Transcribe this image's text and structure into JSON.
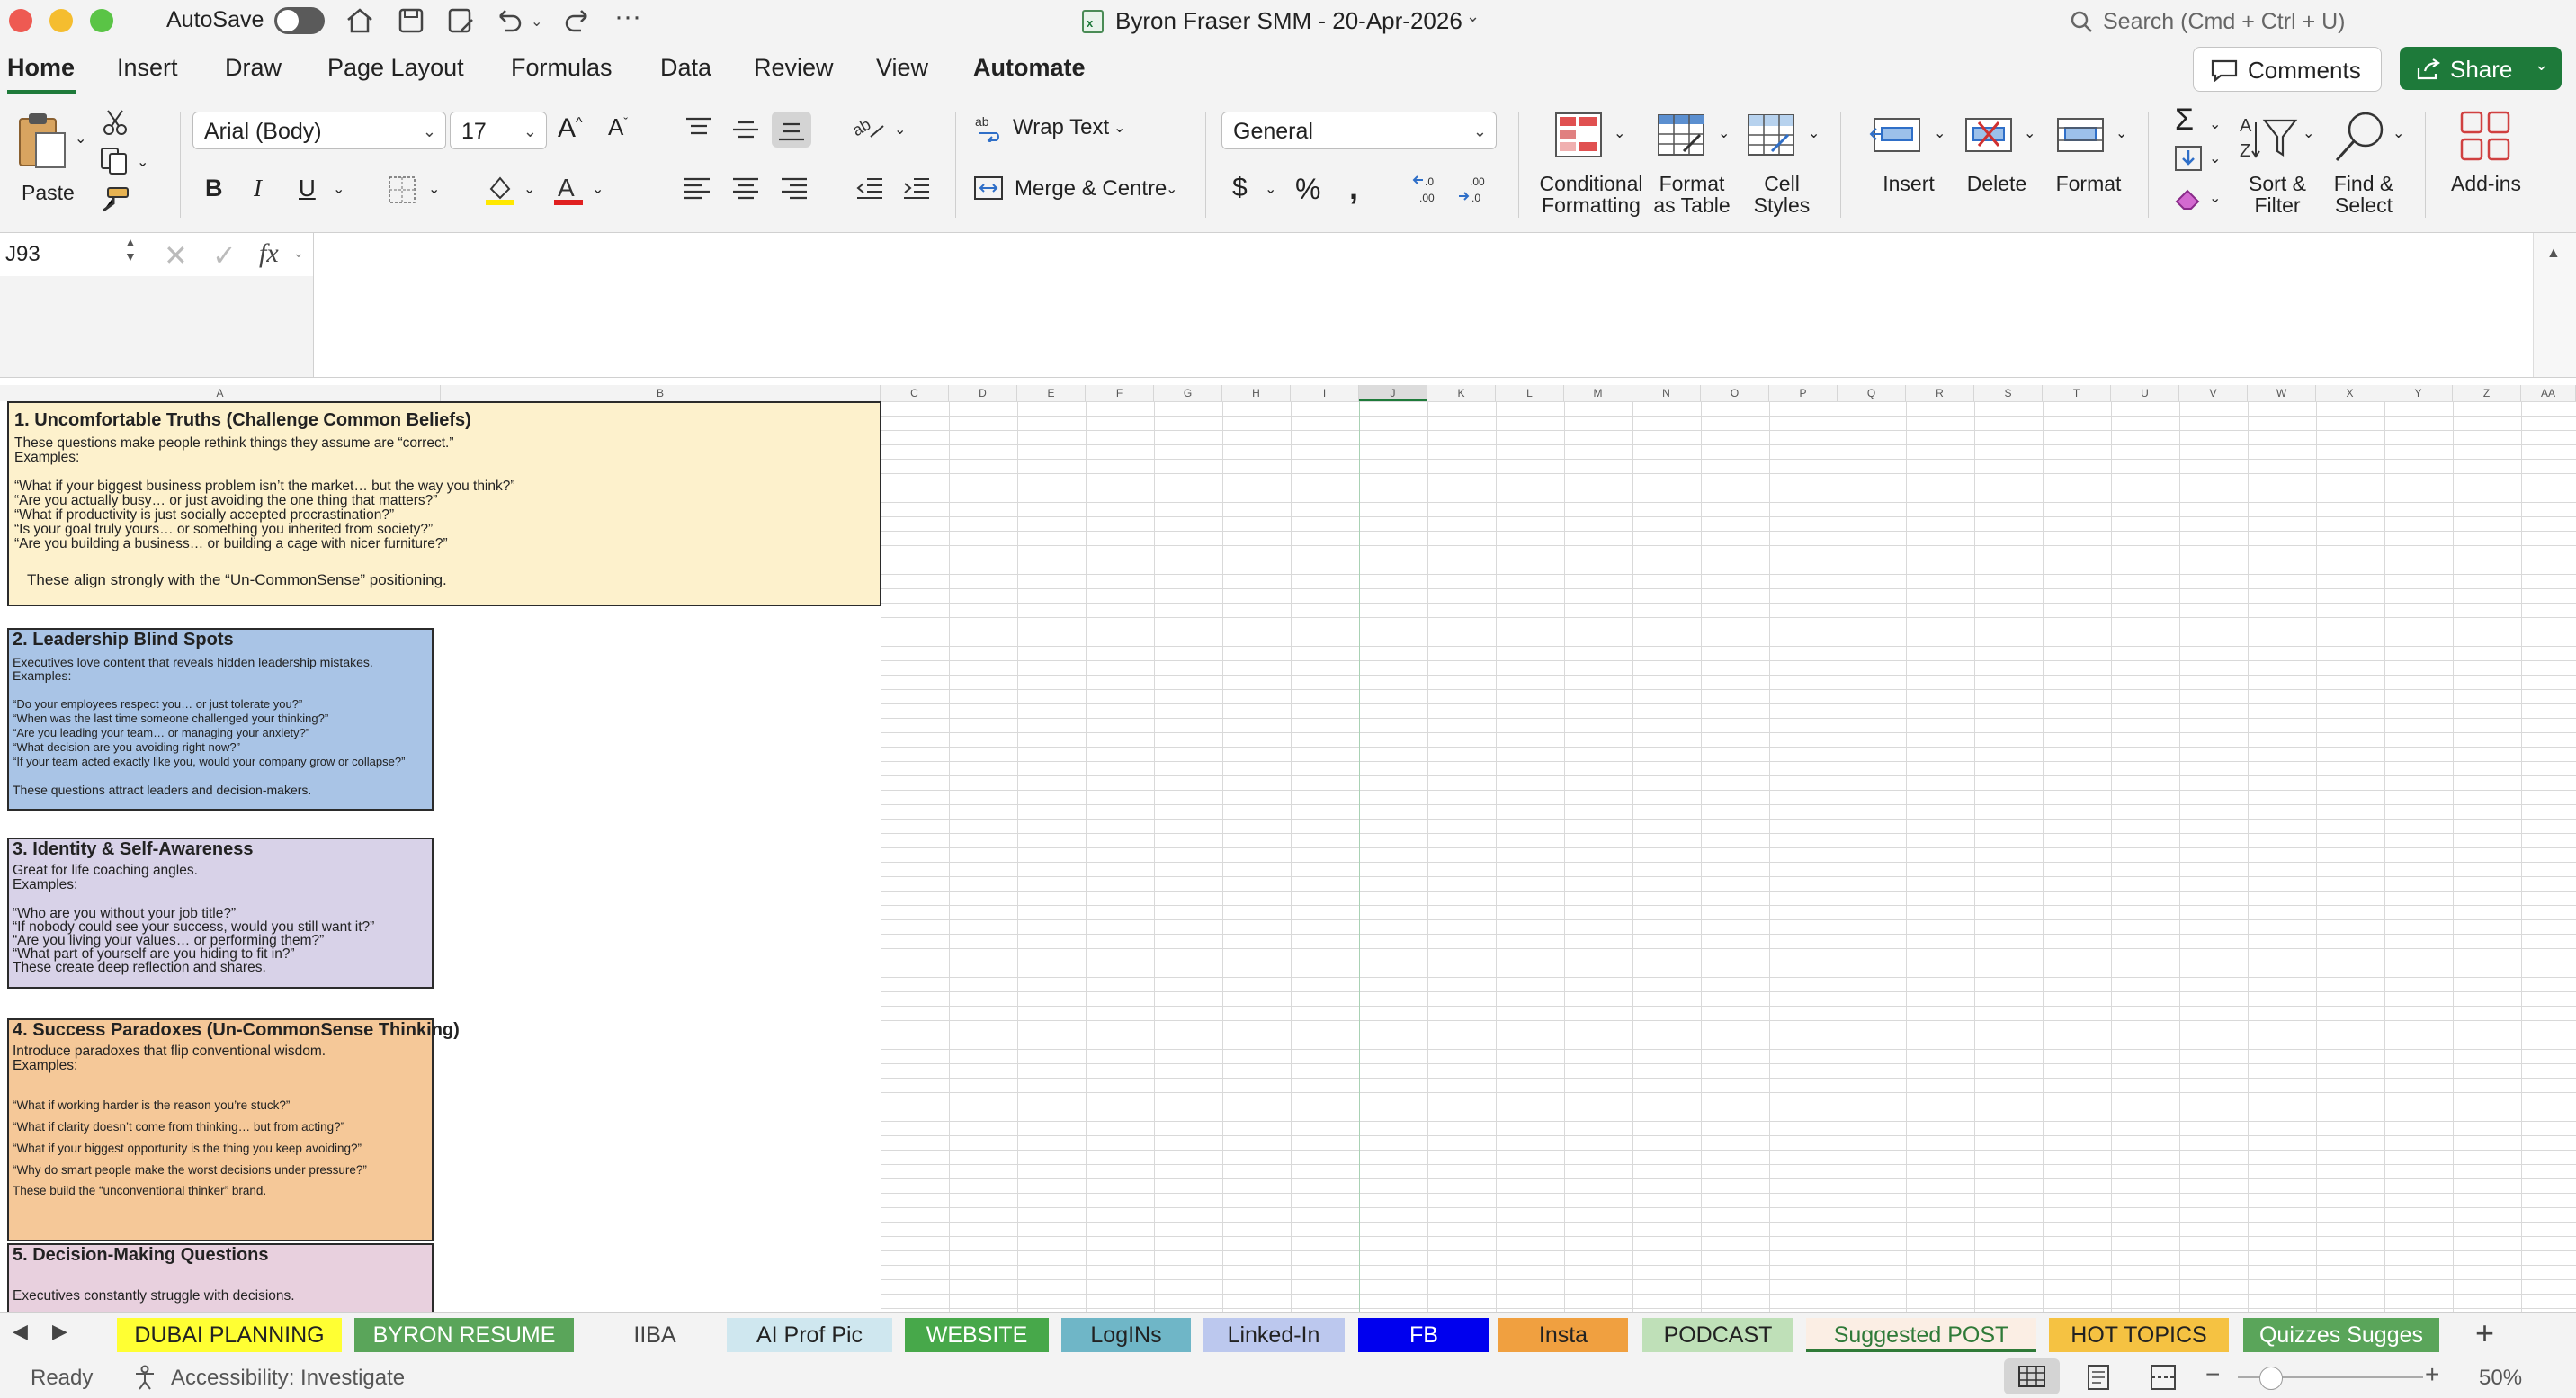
{
  "window": {
    "title": "Byron Fraser SMM - 20-Apr-2026",
    "autosave_label": "AutoSave",
    "search_placeholder": "Search (Cmd + Ctrl + U)"
  },
  "ribbon_tabs": [
    "Home",
    "Insert",
    "Draw",
    "Page Layout",
    "Formulas",
    "Data",
    "Review",
    "View",
    "Automate"
  ],
  "ribbon_buttons": {
    "comments": "Comments",
    "share": "Share",
    "paste": "Paste",
    "font_name": "Arial (Body)",
    "font_size": "17",
    "wrap_text": "Wrap Text",
    "merge_centre": "Merge & Centre",
    "number_format": "General",
    "conditional_formatting": "Conditional\nFormatting",
    "format_as_table": "Format\nas Table",
    "cell_styles": "Cell\nStyles",
    "insert": "Insert",
    "delete": "Delete",
    "format": "Format",
    "sort_filter": "Sort &\nFilter",
    "find_select": "Find &\nSelect",
    "add_ins": "Add-ins",
    "bold": "B",
    "italic": "I",
    "underline": "U"
  },
  "formula_bar": {
    "name_box": "J93",
    "fx": "fx",
    "content": ""
  },
  "columns": [
    "A",
    "B",
    "C",
    "D",
    "E",
    "F",
    "G",
    "H",
    "I",
    "J",
    "K",
    "L",
    "M",
    "N",
    "O",
    "P",
    "Q",
    "R",
    "S",
    "T",
    "U",
    "V",
    "W",
    "X",
    "Y",
    "Z",
    "AA"
  ],
  "selected_column": "J",
  "cards": [
    {
      "heading": "1. Uncomfortable Truths (Challenge Common Beliefs)",
      "intro": "These questions make people rethink things they assume are “correct.”",
      "examples_label": "Examples:",
      "items": [
        "“What if your biggest business problem isn’t the market… but the way you think?”",
        "“Are you actually busy… or just avoiding the one thing that matters?”",
        "“What if productivity is just socially accepted procrastination?”",
        "“Is your goal truly yours… or something you inherited from society?”",
        "“Are you building a business… or building a cage with nicer furniture?”"
      ],
      "footer": "These align strongly with the “Un-CommonSense” positioning.",
      "color": "#fdf1cc"
    },
    {
      "heading": "2. Leadership Blind Spots",
      "intro": "Executives love content that reveals hidden leadership mistakes.",
      "examples_label": "Examples:",
      "items": [
        "“Do your employees respect you… or just tolerate you?”",
        "“When was the last time someone challenged your thinking?”",
        "“Are you leading your team… or managing your anxiety?”",
        "“What decision are you avoiding right now?”",
        "“If your team acted exactly like you, would your company grow or collapse?”"
      ],
      "footer": "These questions attract leaders and decision-makers.",
      "color": "#a9c4e6"
    },
    {
      "heading": "3. Identity & Self-Awareness",
      "intro": "Great for life coaching angles.",
      "examples_label": "Examples:",
      "items": [
        "“Who are you without your job title?”",
        "“If nobody could see your success, would you still want it?”",
        "“Are you living your values… or performing them?”",
        "“What part of yourself are you hiding to fit in?”"
      ],
      "footer": "These create deep reflection and shares.",
      "color": "#d8d2e8"
    },
    {
      "heading": "4. Success Paradoxes (Un-CommonSense Thinking)",
      "intro": "Introduce paradoxes that flip conventional wisdom.",
      "examples_label": "Examples:",
      "items": [
        "“What if working harder is the reason you’re stuck?”",
        "“What if clarity doesn’t come from thinking… but from acting?”",
        "“What if your biggest opportunity is the thing you keep avoiding?”",
        "“Why do smart people make the worst decisions under pressure?”"
      ],
      "footer": "These build the “unconventional thinker” brand.",
      "color": "#f5c898"
    },
    {
      "heading": "5. Decision-Making Questions",
      "intro": "Executives constantly struggle with decisions.",
      "color": "#e8d0de"
    }
  ],
  "sheet_tabs": [
    {
      "label": "DUBAI PLANNING",
      "bg": "#ffff33",
      "fg": "#222222"
    },
    {
      "label": "BYRON RESUME",
      "bg": "#5aa55a",
      "fg": "#ffffff"
    },
    {
      "label": "IIBA",
      "bg": "#f3f3f3",
      "fg": "#444444"
    },
    {
      "label": "AI Prof Pic",
      "bg": "#cfe7ef",
      "fg": "#222222"
    },
    {
      "label": "WEBSITE",
      "bg": "#47a84a",
      "fg": "#ffffff"
    },
    {
      "label": "LogINs",
      "bg": "#6fb6c7",
      "fg": "#222222"
    },
    {
      "label": "Linked-In",
      "bg": "#bcc8ee",
      "fg": "#222222"
    },
    {
      "label": "FB",
      "bg": "#0000ee",
      "fg": "#ffffff"
    },
    {
      "label": "Insta",
      "bg": "#f0a040",
      "fg": "#222222"
    },
    {
      "label": "PODCAST",
      "bg": "#bfe0b8",
      "fg": "#222222"
    },
    {
      "label": "Suggested POST",
      "bg": "#fbeee4",
      "fg": "#2f7a38"
    },
    {
      "label": "HOT TOPICS",
      "bg": "#f5c242",
      "fg": "#222222"
    },
    {
      "label": "Quizzes Sugges",
      "bg": "#5aa55a",
      "fg": "#ffffff"
    }
  ],
  "active_sheet": "Suggested POST",
  "status": {
    "ready": "Ready",
    "accessibility": "Accessibility: Investigate",
    "zoom": "50%"
  }
}
